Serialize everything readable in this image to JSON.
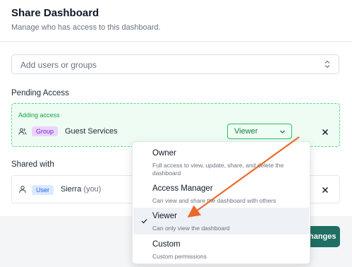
{
  "dialog": {
    "title": "Share Dashboard",
    "subtitle": "Manage who has access to this dashboard.",
    "search_placeholder": "Add users or groups"
  },
  "pending": {
    "section_label": "Pending Access",
    "adding_label": "Adding access",
    "entry": {
      "badge": "Group",
      "name": "Guest Services",
      "role": "Viewer"
    }
  },
  "shared": {
    "section_label": "Shared with",
    "entry": {
      "badge": "User",
      "name": "Sierra",
      "suffix": "(you)"
    }
  },
  "footer": {
    "save_label": "hanges"
  },
  "role_menu": {
    "items": [
      {
        "label": "Owner",
        "description": "Full access to view, update, share, and delete the dashboard",
        "selected": false
      },
      {
        "label": "Access Manager",
        "description": "Can view and share the dashboard with others",
        "selected": false
      },
      {
        "label": "Viewer",
        "description": "Can only view the dashboard",
        "selected": true
      },
      {
        "label": "Custom",
        "description": "Custom permissions",
        "selected": false
      }
    ]
  },
  "colors": {
    "accent_green": "#22c55e",
    "annotation_arrow": "#ea6a2a",
    "primary_button": "#1f6f63"
  }
}
